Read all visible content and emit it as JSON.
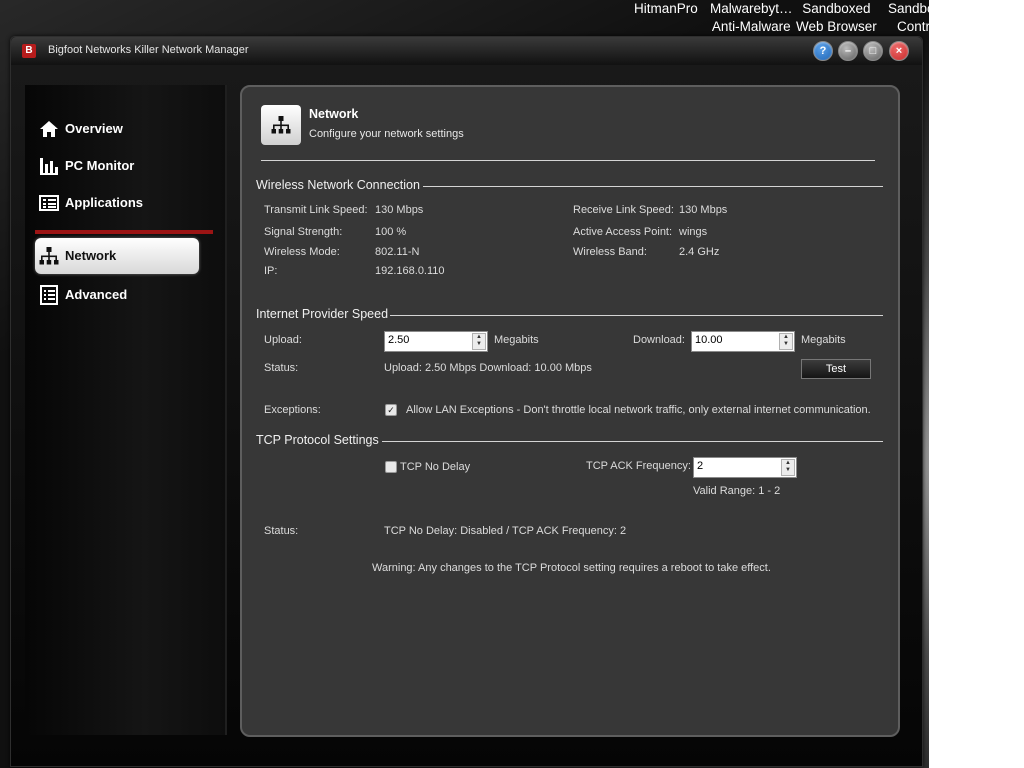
{
  "desktop": {
    "icons": [
      {
        "line1": "HitmanPro",
        "line2": ""
      },
      {
        "line1": "Malwarebyt…",
        "line2": "Anti-Malware"
      },
      {
        "line1": "Sandboxed",
        "line2": "Web Browser"
      },
      {
        "line1": "Sandbo",
        "line2": "Contr"
      }
    ]
  },
  "window": {
    "title": "Bigfoot Networks Killer Network Manager",
    "logo_glyph": "B",
    "buttons": {
      "help": "?",
      "minimize": "–",
      "maximize": "□",
      "close": "×"
    },
    "close_color": "#c62828",
    "help_color": "#1e64b4"
  },
  "sidebar": {
    "items": [
      {
        "label": "Overview",
        "icon": "home-icon"
      },
      {
        "label": "PC Monitor",
        "icon": "bar-chart-icon"
      },
      {
        "label": "Applications",
        "icon": "applications-icon"
      },
      {
        "label": "Network",
        "icon": "network-icon",
        "active": true
      },
      {
        "label": "Advanced",
        "icon": "list-icon"
      }
    ],
    "accent": "#9b1414"
  },
  "header": {
    "title": "Network",
    "subtitle": "Configure your network settings",
    "icon": "network-icon"
  },
  "wireless": {
    "section_title": "Wireless Network Connection",
    "transmit_label": "Transmit Link Speed:",
    "transmit_value": "130  Mbps",
    "receive_label": "Receive Link Speed:",
    "receive_value": "130  Mbps",
    "signal_label": "Signal Strength:",
    "signal_value": "100 %",
    "ap_label": "Active Access Point:",
    "ap_value": "wings",
    "mode_label": "Wireless Mode:",
    "mode_value": "802.11-N",
    "band_label": "Wireless Band:",
    "band_value": "2.4 GHz",
    "ip_label": "IP:",
    "ip_value": "192.168.0.110"
  },
  "internet": {
    "section_title": "Internet Provider Speed",
    "upload_label": "Upload:",
    "upload_value": "2.50",
    "upload_unit": "Megabits",
    "download_label": "Download:",
    "download_value": "10.00",
    "download_unit": "Megabits",
    "status_label": "Status:",
    "status_value": "Upload: 2.50 Mbps Download: 10.00 Mbps",
    "test_label": "Test",
    "exceptions_label": "Exceptions:",
    "exceptions_checked": true,
    "exceptions_text": "Allow LAN Exceptions - Don't throttle local network traffic, only external internet communication."
  },
  "tcp": {
    "section_title": "TCP Protocol Settings",
    "nodelay_label": "TCP No Delay",
    "nodelay_checked": false,
    "ack_label": "TCP ACK Frequency:",
    "ack_value": "2",
    "valid_range": "Valid Range: 1 - 2",
    "status_label": "Status:",
    "status_value": "TCP No Delay: Disabled / TCP ACK Frequency: 2",
    "warning": "Warning: Any changes to the TCP Protocol setting requires a reboot to take effect."
  }
}
